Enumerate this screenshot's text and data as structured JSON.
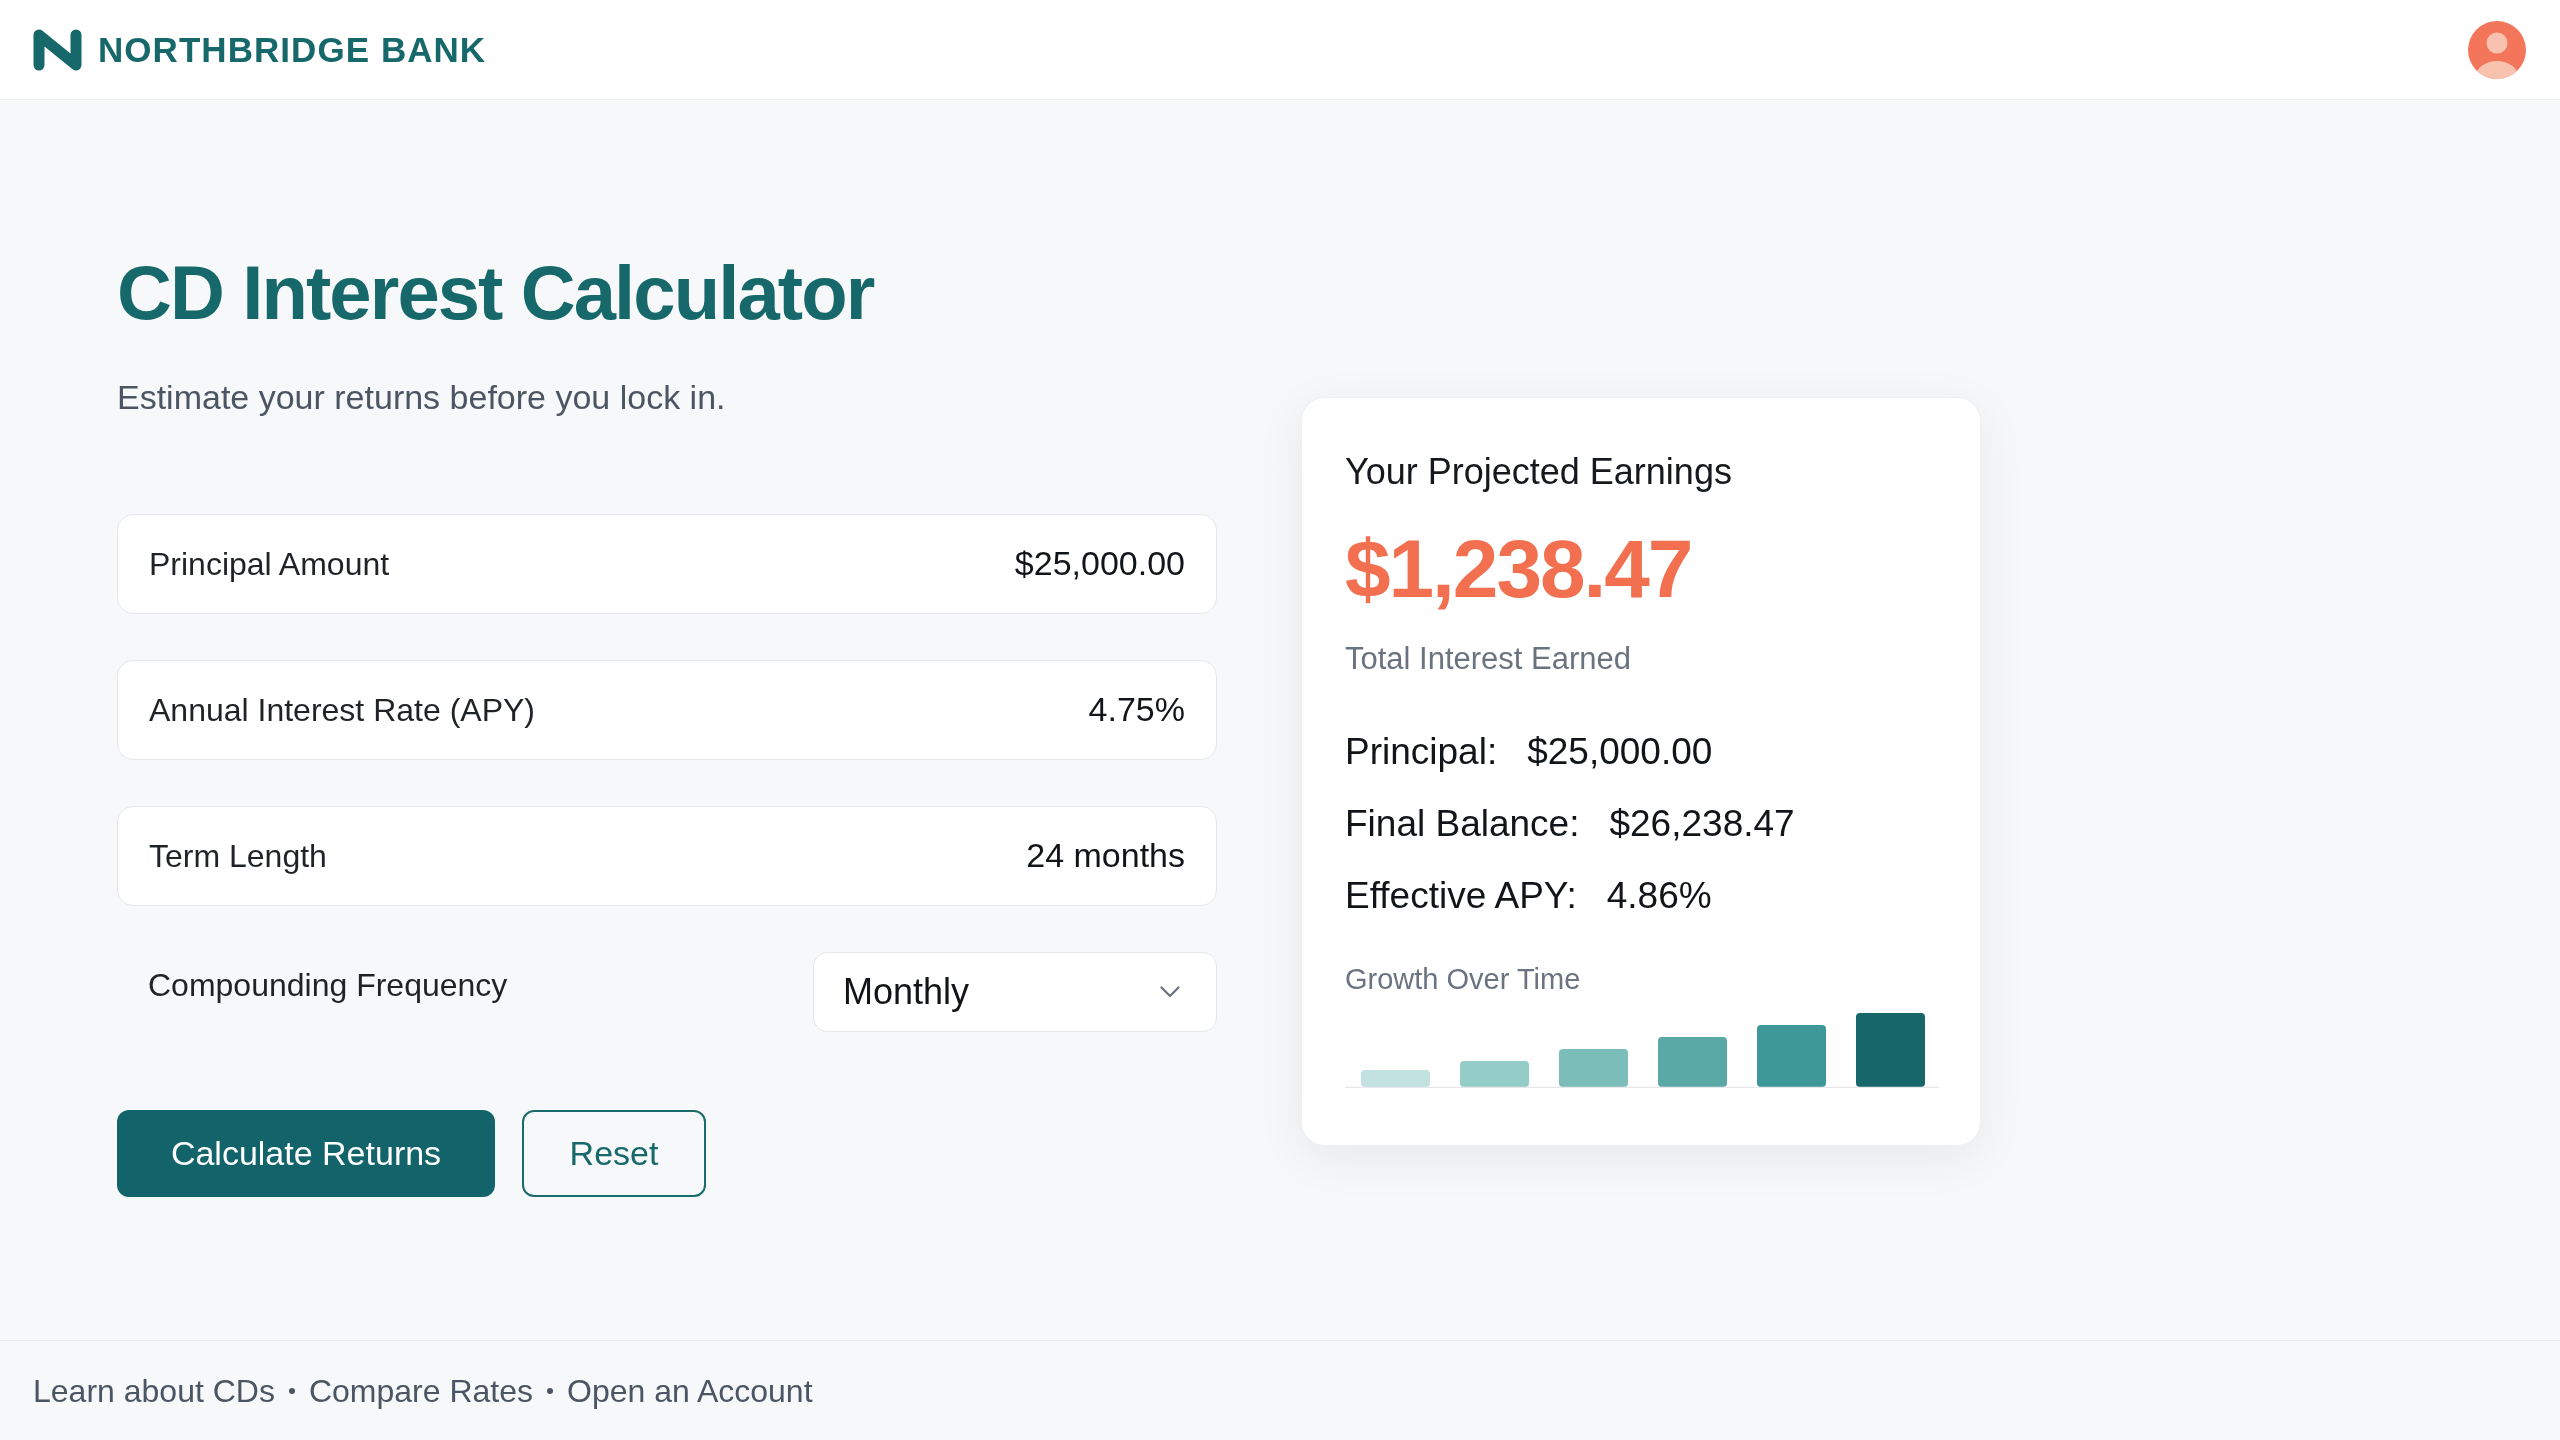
{
  "header": {
    "brand": "NORTHBRIDGE BANK"
  },
  "page": {
    "title": "CD Interest Calculator",
    "subtitle": "Estimate your returns before you lock in."
  },
  "fields": [
    {
      "kind": "input",
      "label": "Principal Amount",
      "value": "$25,000.00"
    },
    {
      "kind": "input",
      "label": "Annual Interest Rate (APY)",
      "value": "4.75%"
    },
    {
      "kind": "input",
      "label": "Term Length",
      "value": "24 months"
    },
    {
      "kind": "select",
      "label": "Compounding Frequency",
      "value": "Monthly"
    }
  ],
  "buttons": [
    {
      "kind": "primary",
      "label": "Calculate Returns"
    },
    {
      "kind": "secondary",
      "label": "Reset"
    }
  ],
  "results": {
    "title": "Your Projected Earnings",
    "amount": "$1,238.47",
    "amount_label": "Total Interest Earned",
    "rows": [
      {
        "label": "Principal:",
        "value": "$25,000.00"
      },
      {
        "label": "Final Balance:",
        "value": "$26,238.47"
      },
      {
        "label": "Effective APY:",
        "value": "4.86%"
      }
    ],
    "chart_title": "Growth Over Time"
  },
  "footer": {
    "links": [
      "Learn about CDs",
      "Compare Rates",
      "Open an Account"
    ]
  }
}
